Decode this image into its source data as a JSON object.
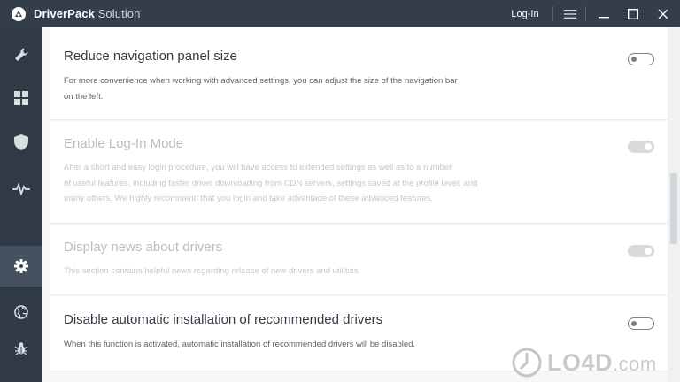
{
  "window": {
    "brand": "DriverPack",
    "brand_suffix": " Solution",
    "login_label": "Log-In",
    "menu_icon": "hamburger-menu-icon",
    "minimize_icon": "minimize-icon",
    "maximize_icon": "maximize-icon",
    "close_icon": "close-icon"
  },
  "sidebar": {
    "items": [
      {
        "icon": "wrench-icon"
      },
      {
        "icon": "grid-icon"
      },
      {
        "icon": "shield-icon"
      },
      {
        "icon": "pulse-icon"
      },
      {
        "icon": "gear-icon",
        "active": true
      },
      {
        "icon": "globe-icon"
      },
      {
        "icon": "bug-icon"
      }
    ]
  },
  "settings": [
    {
      "title": "Reduce navigation panel size",
      "lines": [
        "For more convenience when working with advanced settings, you can adjust the size of the navigation bar",
        "on the left."
      ],
      "toggle": "off",
      "disabled": false
    },
    {
      "title": "Enable Log-In Mode",
      "lines": [
        "After a short and easy login procedure, you will have access to extended settings as well as to a number",
        "of useful features, including faster driver downloading from CDN servers, settings saved at the profile level, and",
        "many others. We highly recommend that you login and take advantage of these advanced features."
      ],
      "toggle": "on",
      "disabled": true
    },
    {
      "title": "Display news about drivers",
      "lines": [
        "This section contains helpful news regarding release of new drivers and utilities."
      ],
      "toggle": "on",
      "disabled": true
    },
    {
      "title": "Disable automatic installation of recommended drivers",
      "lines": [
        "When this function is activated, automatic installation of recommended drivers will be disabled."
      ],
      "toggle": "off",
      "disabled": false
    }
  ],
  "watermark": {
    "text": "LO4D",
    "suffix": ".com",
    "colors": {
      "gray": "#b4b9be"
    }
  },
  "colors": {
    "titlebar": "#333e4a",
    "sidebar": "#2f3a46",
    "sidebar_active": "#445060",
    "content_bg": "#f6f7f8"
  }
}
